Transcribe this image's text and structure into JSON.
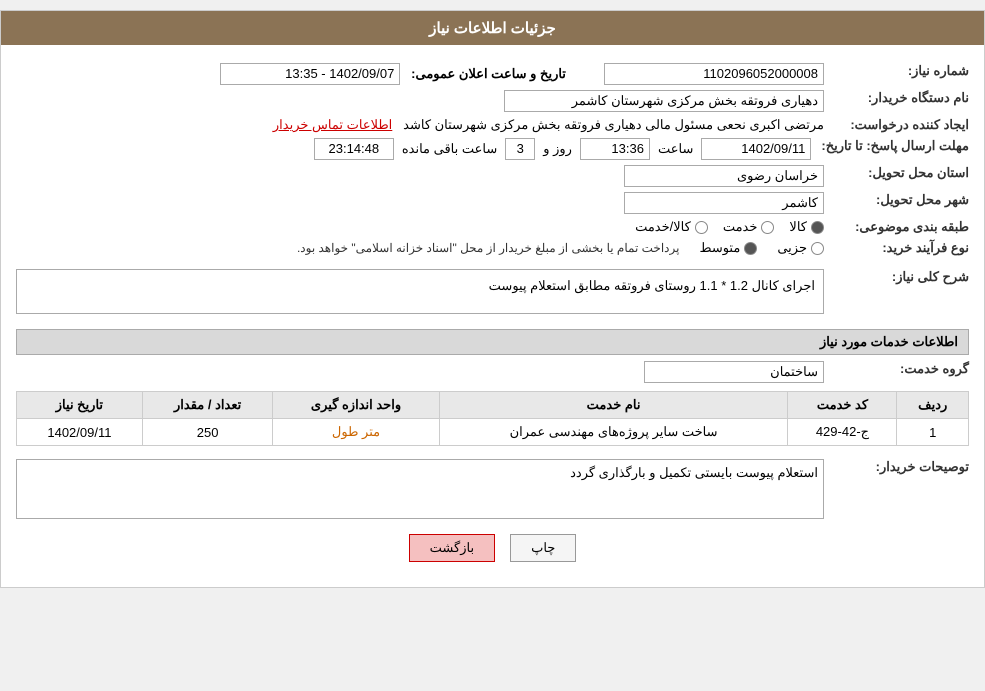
{
  "header": {
    "title": "جزئیات اطلاعات نیاز"
  },
  "fields": {
    "need_number_label": "شماره نیاز:",
    "need_number_value": "1102096052000008",
    "buyer_org_label": "نام دستگاه خریدار:",
    "buyer_org_value": "دهیاری فروتقه بخش مرکزی شهرستان کاشمر",
    "announcement_label": "تاریخ و ساعت اعلان عمومی:",
    "announcement_value": "1402/09/07 - 13:35",
    "creator_label": "ایجاد کننده درخواست:",
    "creator_value": "مرتضی اکبری نحعی مسئول مالی دهیاری فروتقه بخش مرکزی شهرستان کاشد",
    "contact_link": "اطلاعات تماس خریدار",
    "deadline_label": "مهلت ارسال پاسخ: تا تاریخ:",
    "deadline_date": "1402/09/11",
    "deadline_time_label": "ساعت",
    "deadline_time": "13:36",
    "deadline_day_label": "روز و",
    "deadline_days": "3",
    "deadline_remaining_label": "ساعت باقی مانده",
    "deadline_remaining": "23:14:48",
    "province_label": "استان محل تحویل:",
    "province_value": "خراسان رضوی",
    "city_label": "شهر محل تحویل:",
    "city_value": "کاشمر",
    "category_label": "طبقه بندی موضوعی:",
    "category_options": [
      "کالا",
      "خدمت",
      "کالا/خدمت"
    ],
    "category_selected": "کالا",
    "purchase_type_label": "نوع فرآیند خرید:",
    "purchase_type_options": [
      "جزیی",
      "متوسط"
    ],
    "purchase_type_selected": "متوسط",
    "purchase_type_desc": "پرداخت تمام یا بخشی از مبلغ خریدار از محل \"اسناد خزانه اسلامی\" خواهد بود.",
    "need_desc_label": "شرح کلی نیاز:",
    "need_desc_value": "اجرای کانال 1.2 * 1.1 روستای فروتقه مطابق استعلام پیوست",
    "services_section_title": "اطلاعات خدمات مورد نیاز",
    "service_group_label": "گروه خدمت:",
    "service_group_value": "ساختمان",
    "table_headers": [
      "ردیف",
      "کد خدمت",
      "نام خدمت",
      "واحد اندازه گیری",
      "تعداد / مقدار",
      "تاریخ نیاز"
    ],
    "table_rows": [
      {
        "row": "1",
        "code": "ج-42-429",
        "name": "ساخت سایر پروژه‌های مهندسی عمران",
        "unit": "متر طول",
        "quantity": "250",
        "date": "1402/09/11"
      }
    ],
    "buyer_notes_label": "توصیحات خریدار:",
    "buyer_notes_value": "استعلام پیوست بایستی تکمیل و بارگذاری گردد"
  },
  "buttons": {
    "print_label": "چاپ",
    "back_label": "بازگشت"
  }
}
